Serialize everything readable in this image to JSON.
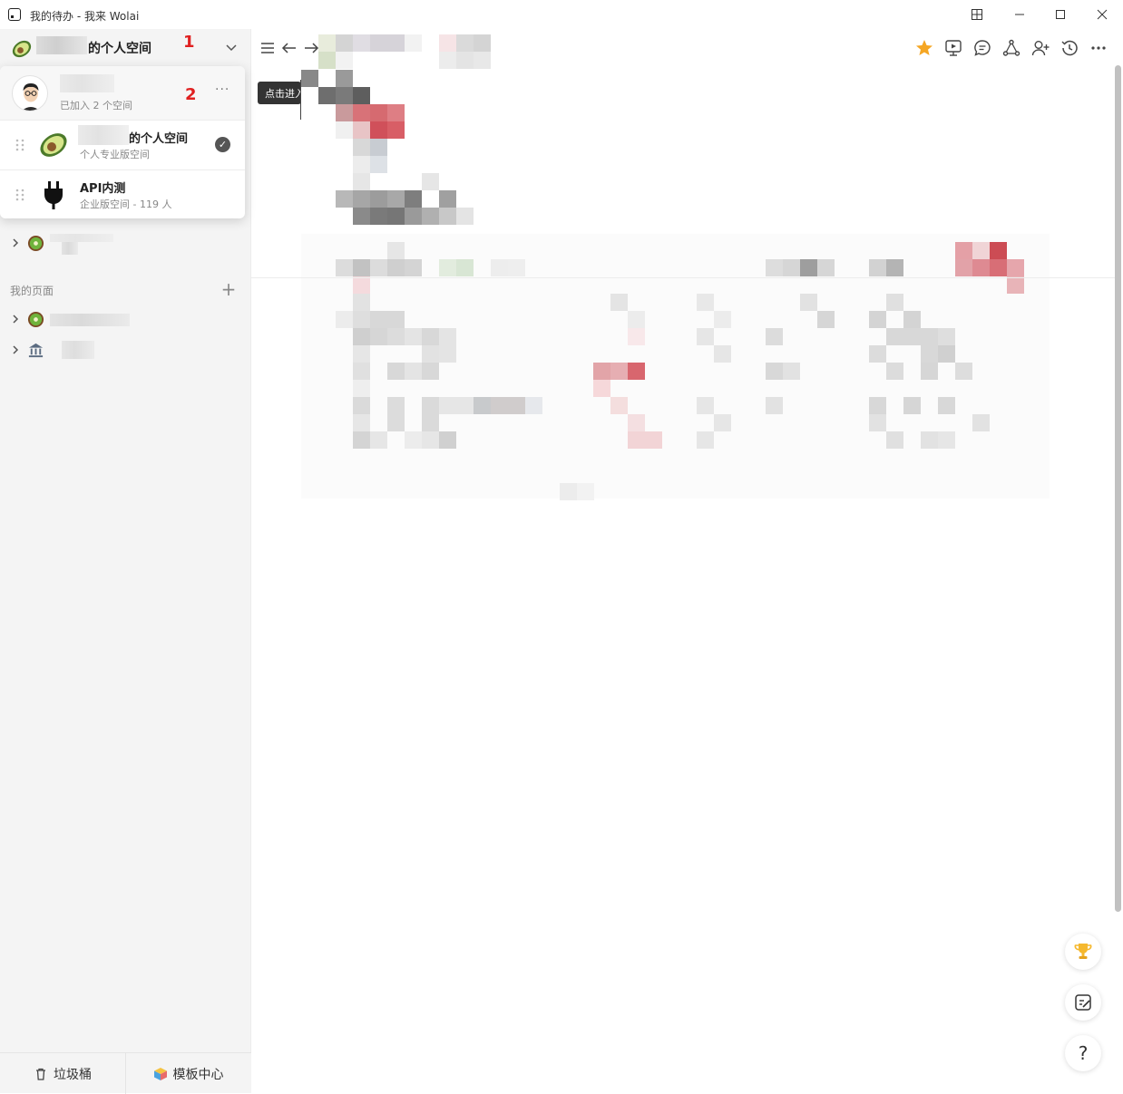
{
  "window": {
    "title": "我的待办 - 我来 Wolai",
    "controls": [
      "layout-icon",
      "minimize-icon",
      "maximize-icon",
      "close-icon"
    ]
  },
  "sidebar": {
    "workspace_name": "的个人空间",
    "annotation_1": "1",
    "section_label": "我的页面",
    "bottom": {
      "trash_label": "垃圾桶",
      "templates_label": "模板中心"
    }
  },
  "popover": {
    "joined_text": "已加入 2 个空间",
    "annotation_2": "2",
    "workspaces": [
      {
        "name": "的个人空间",
        "subtitle": "个人专业版空间",
        "icon": "avocado-icon",
        "selected": true
      },
      {
        "name": "API内测",
        "subtitle": "企业版空间 - 119 人",
        "icon": "plug-icon",
        "selected": false
      }
    ]
  },
  "main": {
    "tooltip": "点击进入",
    "toolbar_icons": [
      "star-icon",
      "present-icon",
      "comment-icon",
      "graph-icon",
      "share-user-icon",
      "history-icon",
      "more-icon"
    ],
    "float_buttons": [
      "trophy-icon",
      "edit-note-icon",
      "help-icon"
    ],
    "help_label": "?"
  },
  "colors": {
    "accent_star": "#f5a623",
    "annotation_red": "#e02020"
  }
}
